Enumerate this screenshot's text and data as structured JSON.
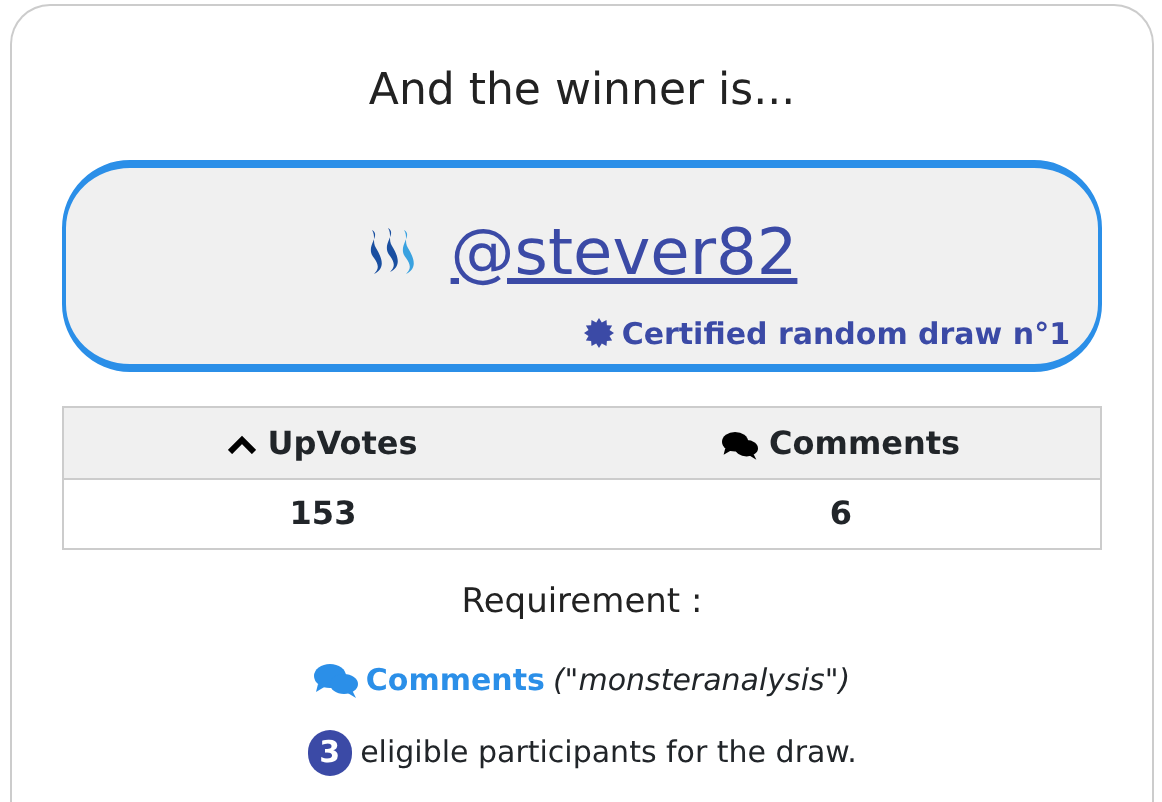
{
  "heading": "And the winner is...",
  "winner": {
    "username": "@stever82",
    "certificate": "Certified random draw n°1"
  },
  "stats": {
    "columns": [
      {
        "label": "UpVotes",
        "kind": "caret"
      },
      {
        "label": "Comments",
        "kind": "comments"
      }
    ],
    "values": [
      "153",
      "6"
    ]
  },
  "requirement": {
    "title": "Requirement :",
    "label": "Comments",
    "detail": "(\"monsteranalysis\")"
  },
  "participants": {
    "count": "3",
    "text": "eligible participants for the draw."
  }
}
